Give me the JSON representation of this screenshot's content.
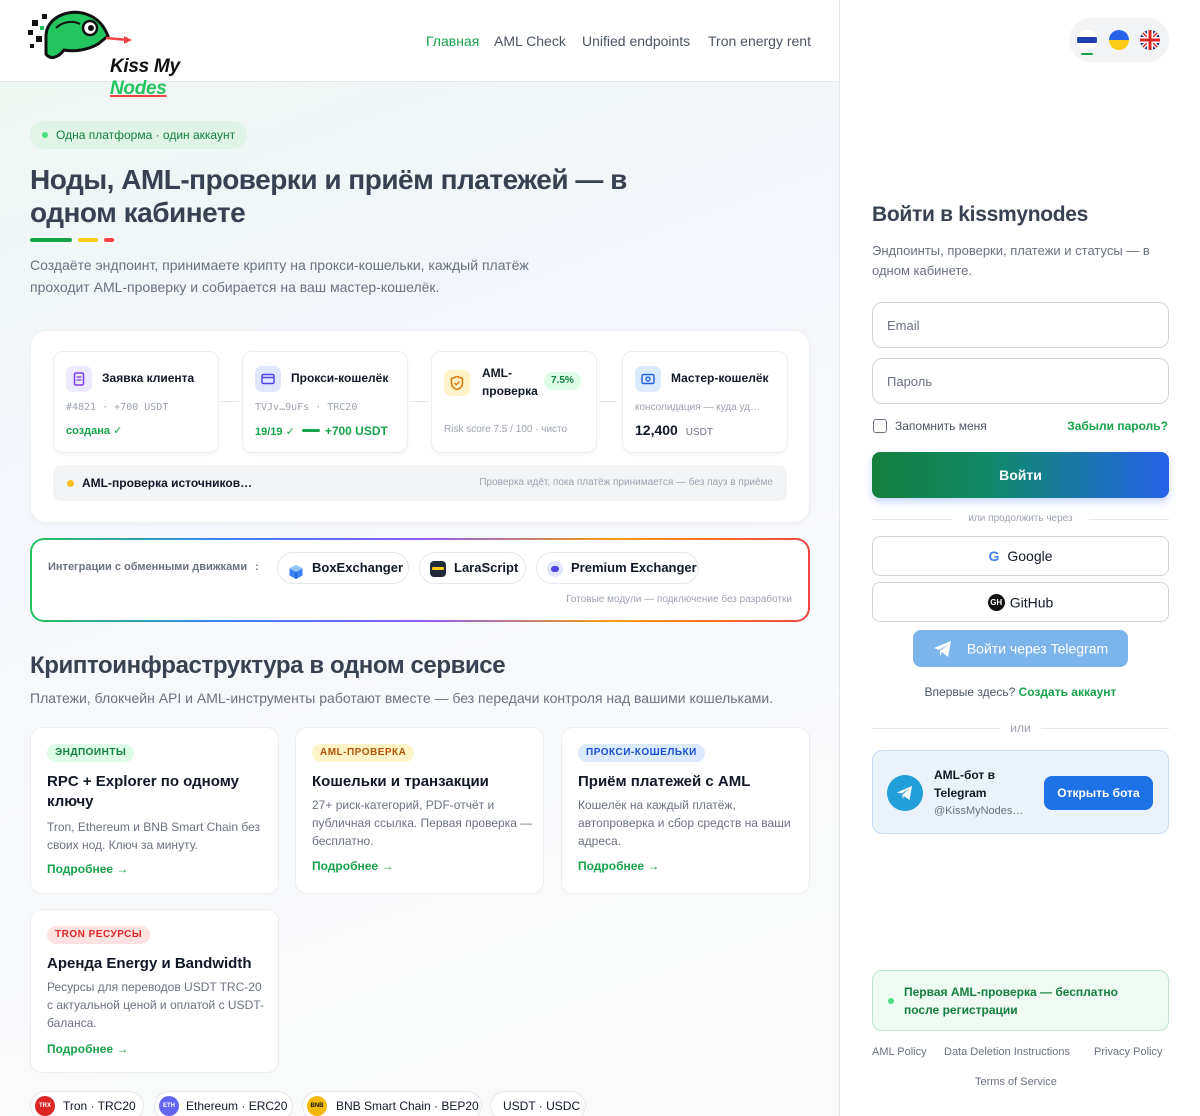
{
  "logo": {
    "text_a": "Kiss My ",
    "text_b": "Nodes"
  },
  "nav": [
    "Главная",
    "AML Check",
    "Unified endpoints",
    "Tron energy rent"
  ],
  "hero": {
    "pill": "Одна платформа · один аккаунт",
    "title": "Ноды, AML-проверки и приём платежей — в одном кабинете",
    "lead": "Создаёте эндпоинт, принимаете крипту на прокси-кошельки, каждый платёж проходит AML-проверку и собирается на ваш мастер-кошелёк."
  },
  "flow": {
    "steps": [
      {
        "title": "Заявка клиента",
        "sub": "#4821  ·  +700 USDT",
        "foot": "создана ✓"
      },
      {
        "title": "Прокси-кошелёк",
        "sub": "TVJv…9uFs  ·  TRC20",
        "foot_a": "19/19 ✓",
        "foot_b": "+700 USDT"
      },
      {
        "title": "AML-проверка",
        "badge": "7.5%",
        "sub": "Risk score 7.5 / 100 · чисто"
      },
      {
        "title": "Мастер-кошелёк",
        "sub": "консолидация — куда уд…",
        "amount": "12,400",
        "unit": "USDT"
      }
    ],
    "status_left": "AML-проверка источников…",
    "status_right": "Проверка идёт, пока платёж принимается — без пауз в приёме"
  },
  "integrations": {
    "label": "Интеграции с обменными движками",
    "sep": ":",
    "items": [
      "BoxExchanger",
      "LaraScript",
      "Premium Exchanger"
    ],
    "note": "Готовые модули — подключение без разработки"
  },
  "section": {
    "title": "Криптоинфраструктура в одном сервисе",
    "sub": "Платежи, блокчейн API и AML-инструменты работают вместе — без передачи контроля над вашими кошельками."
  },
  "cards": [
    {
      "tag": "ЭНДПОИНТЫ",
      "title": "RPC + Explorer по одному ключу",
      "desc": "Tron, Ethereum и BNB Smart Chain без своих нод. Ключ за минуту.",
      "more": "Подробнее →"
    },
    {
      "tag": "AML-ПРОВЕРКА",
      "title": "Кошельки и транзакции",
      "desc": "27+ риск-категорий, PDF-отчёт и публичная ссылка. Первая проверка — бесплатно.",
      "more": "Подробнее →"
    },
    {
      "tag": "ПРОКСИ-КОШЕЛЬКИ",
      "title": "Приём платежей с AML",
      "desc": "Кошелёк на каждый платёж, автопроверка и сбор средств на ваши адреса.",
      "more": "Подробнее →"
    },
    {
      "tag": "TRON РЕСУРСЫ",
      "title": "Аренда Energy и Bandwidth",
      "desc": "Ресурсы для переводов USDT TRC-20 с актуальной ценой и оплатой с USDT-баланса.",
      "more": "Подробнее →"
    }
  ],
  "networks": [
    {
      "icon": "TRX",
      "label": "Tron · TRC20"
    },
    {
      "icon": "ETH",
      "label": "Ethereum · ERC20"
    },
    {
      "icon": "BNB",
      "label": "BNB Smart Chain · BEP20"
    },
    {
      "label": "USDT · USDC"
    }
  ],
  "login": {
    "title": "Войти в kissmynodes",
    "sub": "Эндпоинты, проверки, платежи и статусы — в одном кабинете.",
    "email_placeholder": "Email",
    "password_placeholder": "Пароль",
    "remember": "Запомнить меня",
    "forgot": "Забыли пароль?",
    "submit": "Войти",
    "or_continue": "или продолжить через",
    "google": "Google",
    "github": "GitHub",
    "telegram": "Войти через Telegram",
    "new_here": "Впервые здесь?",
    "create": "Создать аккаунт",
    "or": "или",
    "bot_title": "AML-бот в Telegram",
    "bot_handle": "@KissMyNodes…",
    "bot_button": "Открыть бота",
    "notice": "Первая AML-проверка — бесплатно после регистрации",
    "footer_links": [
      "AML Policy",
      "Data Deletion Instructions",
      "Privacy Policy",
      "Terms of Service"
    ]
  },
  "colors": {
    "brand_green": "#16a34a",
    "brand_blue": "#2563eb",
    "telegram": "#229ed9"
  }
}
